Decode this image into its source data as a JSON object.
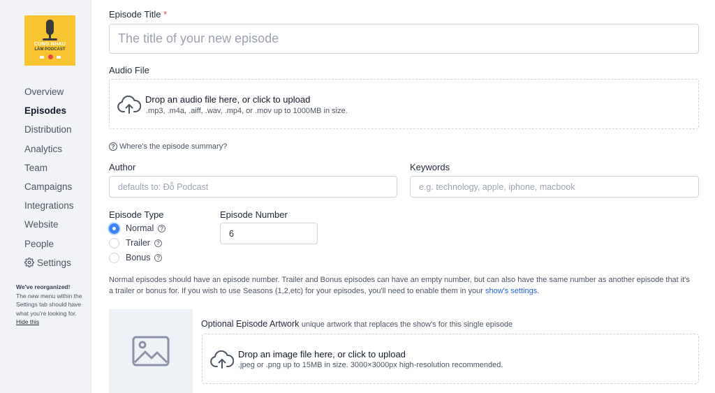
{
  "sidebar": {
    "cover": {
      "line1": "CÙNG NHAU",
      "line2": "LÀM PODCAST"
    },
    "items": [
      {
        "label": "Overview",
        "active": false
      },
      {
        "label": "Episodes",
        "active": true
      },
      {
        "label": "Distribution",
        "active": false
      },
      {
        "label": "Analytics",
        "active": false
      },
      {
        "label": "Team",
        "active": false
      },
      {
        "label": "Campaigns",
        "active": false
      },
      {
        "label": "Integrations",
        "active": false
      },
      {
        "label": "Website",
        "active": false
      },
      {
        "label": "People",
        "active": false
      },
      {
        "label": "Settings",
        "active": false,
        "icon": "gear-icon"
      }
    ],
    "notice": {
      "heading": "We've reorganized!",
      "body": "The new menu within the Settings tab should have what you're looking for.",
      "hide_label": "Hide this"
    }
  },
  "form": {
    "title_label": "Episode Title",
    "required_mark": "*",
    "title_placeholder": "The title of your new episode",
    "audio_label": "Audio File",
    "audio_drop_title": "Drop an audio file here, or click to upload",
    "audio_drop_sub": ".mp3, .m4a, .aiff, .wav, .mp4, or .mov up to 1000MB in size.",
    "summary_help": "Where's the episode summary?",
    "author_label": "Author",
    "author_placeholder": "defaults to: Đỗ Podcast",
    "keywords_label": "Keywords",
    "keywords_placeholder": "e.g. technology, apple, iphone, macbook",
    "episode_type_label": "Episode Type",
    "episode_types": [
      {
        "label": "Normal",
        "checked": true
      },
      {
        "label": "Trailer",
        "checked": false
      },
      {
        "label": "Bonus",
        "checked": false
      }
    ],
    "episode_number_label": "Episode Number",
    "episode_number_value": "6",
    "note_text": "Normal episodes should have an episode number. Trailer and Bonus episodes can have an empty number, but can also have the same number as another episode that it's a trailer or bonus for. If you wish to use Seasons (1,2,etc) for your episodes, you'll need to enable them in your ",
    "note_link": "show's settings",
    "note_end": ".",
    "artwork_label": "Optional Episode Artwork",
    "artwork_sub": "unique artwork that replaces the show's for this single episode",
    "artwork_drop_title": "Drop an image file here, or click to upload",
    "artwork_drop_sub": ".jpeg or .png up to 15MB in size. 3000×3000px high-resolution recommended."
  },
  "colors": {
    "accent": "#3b82f6",
    "link": "#2563eb",
    "required": "#e53e3e",
    "cover": "#f7c531",
    "sidebar_bg": "#f1f3f6"
  }
}
